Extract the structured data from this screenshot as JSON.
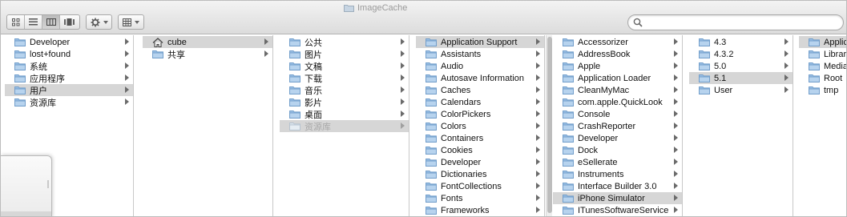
{
  "window": {
    "title": "ImageCache"
  },
  "search": {
    "value": "",
    "placeholder": ""
  },
  "columns": [
    {
      "items": [
        {
          "label": "Developer",
          "icon": "folder-icon",
          "arrow": true
        },
        {
          "label": "lost+found",
          "icon": "folder-icon",
          "arrow": true
        },
        {
          "label": "系统",
          "icon": "folder-icon",
          "arrow": true
        },
        {
          "label": "应用程序",
          "icon": "folder-icon",
          "arrow": true
        },
        {
          "label": "用户",
          "icon": "folder-icon",
          "arrow": true,
          "selected": true
        },
        {
          "label": "资源库",
          "icon": "folder-icon",
          "arrow": true
        }
      ]
    },
    {
      "items": [
        {
          "label": "cube",
          "icon": "home-icon",
          "arrow": true,
          "selected": true
        },
        {
          "label": "共享",
          "icon": "folder-icon",
          "arrow": true
        }
      ]
    },
    {
      "items": [
        {
          "label": "公共",
          "icon": "folder-icon",
          "arrow": true
        },
        {
          "label": "图片",
          "icon": "folder-icon",
          "arrow": true
        },
        {
          "label": "文稿",
          "icon": "folder-icon",
          "arrow": true
        },
        {
          "label": "下载",
          "icon": "folder-icon",
          "arrow": true
        },
        {
          "label": "音乐",
          "icon": "folder-icon",
          "arrow": true
        },
        {
          "label": "影片",
          "icon": "folder-icon",
          "arrow": true
        },
        {
          "label": "桌面",
          "icon": "folder-icon",
          "arrow": true
        },
        {
          "label": "资源库",
          "icon": "folder-icon",
          "arrow": true,
          "selected": true,
          "dim": true
        }
      ]
    },
    {
      "items": [
        {
          "label": "Application Support",
          "icon": "folder-icon",
          "arrow": true,
          "selected": true
        },
        {
          "label": "Assistants",
          "icon": "folder-icon",
          "arrow": true
        },
        {
          "label": "Audio",
          "icon": "folder-icon",
          "arrow": true
        },
        {
          "label": "Autosave Information",
          "icon": "folder-icon",
          "arrow": true
        },
        {
          "label": "Caches",
          "icon": "folder-icon",
          "arrow": true
        },
        {
          "label": "Calendars",
          "icon": "folder-icon",
          "arrow": true
        },
        {
          "label": "ColorPickers",
          "icon": "folder-icon",
          "arrow": true
        },
        {
          "label": "Colors",
          "icon": "folder-icon",
          "arrow": true
        },
        {
          "label": "Containers",
          "icon": "folder-icon",
          "arrow": true
        },
        {
          "label": "Cookies",
          "icon": "folder-icon",
          "arrow": true
        },
        {
          "label": "Developer",
          "icon": "folder-icon",
          "arrow": true
        },
        {
          "label": "Dictionaries",
          "icon": "folder-icon",
          "arrow": true
        },
        {
          "label": "FontCollections",
          "icon": "folder-icon",
          "arrow": true
        },
        {
          "label": "Fonts",
          "icon": "folder-icon",
          "arrow": true
        },
        {
          "label": "Frameworks",
          "icon": "folder-icon",
          "arrow": true
        }
      ]
    },
    {
      "items": [
        {
          "label": "Accessorizer",
          "icon": "folder-icon",
          "arrow": true
        },
        {
          "label": "AddressBook",
          "icon": "folder-icon",
          "arrow": true
        },
        {
          "label": "Apple",
          "icon": "folder-icon",
          "arrow": true
        },
        {
          "label": "Application Loader",
          "icon": "folder-icon",
          "arrow": true
        },
        {
          "label": "CleanMyMac",
          "icon": "folder-icon",
          "arrow": true
        },
        {
          "label": "com.apple.QuickLook",
          "icon": "folder-icon",
          "arrow": true
        },
        {
          "label": "Console",
          "icon": "folder-icon",
          "arrow": true
        },
        {
          "label": "CrashReporter",
          "icon": "folder-icon",
          "arrow": true
        },
        {
          "label": "Developer",
          "icon": "folder-icon",
          "arrow": true
        },
        {
          "label": "Dock",
          "icon": "folder-icon",
          "arrow": true
        },
        {
          "label": "eSellerate",
          "icon": "folder-icon",
          "arrow": true
        },
        {
          "label": "Instruments",
          "icon": "folder-icon",
          "arrow": true
        },
        {
          "label": "Interface Builder 3.0",
          "icon": "folder-icon",
          "arrow": true
        },
        {
          "label": "iPhone Simulator",
          "icon": "folder-icon",
          "arrow": true,
          "selected": true
        },
        {
          "label": "ITunesSoftwareService",
          "icon": "folder-icon",
          "arrow": true
        }
      ]
    },
    {
      "items": [
        {
          "label": "4.3",
          "icon": "folder-icon",
          "arrow": true
        },
        {
          "label": "4.3.2",
          "icon": "folder-icon",
          "arrow": true
        },
        {
          "label": "5.0",
          "icon": "folder-icon",
          "arrow": true
        },
        {
          "label": "5.1",
          "icon": "folder-icon",
          "arrow": true,
          "selected": true
        },
        {
          "label": "User",
          "icon": "folder-icon",
          "arrow": true
        }
      ]
    },
    {
      "items": [
        {
          "label": "Applications",
          "icon": "folder-icon",
          "arrow": false,
          "selected": true
        },
        {
          "label": "Library",
          "icon": "folder-icon",
          "arrow": false
        },
        {
          "label": "Media",
          "icon": "folder-icon",
          "arrow": false
        },
        {
          "label": "Root",
          "icon": "folder-icon",
          "arrow": false
        },
        {
          "label": "tmp",
          "icon": "folder-icon",
          "arrow": false
        }
      ]
    }
  ],
  "colors": {
    "selection": "#d6d6d6",
    "folder": "#9cc1e6",
    "folder_dark": "#6f9cc9"
  }
}
